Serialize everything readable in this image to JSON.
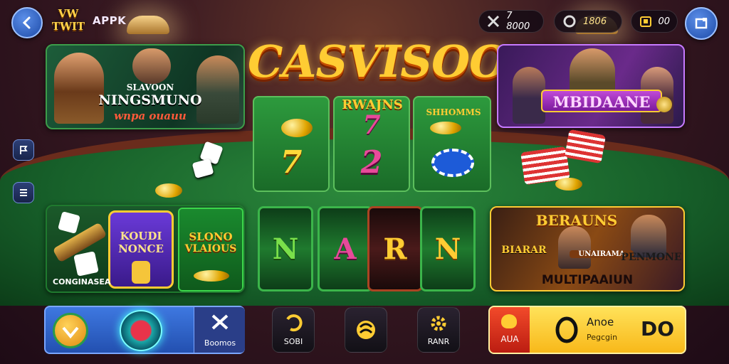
{
  "header": {
    "logo_text": "VW TWIT",
    "app_name": "APPK",
    "currency_1": "7 8000",
    "currency_2": "1806",
    "currency_3": "00"
  },
  "main_logo": "CASVISOO",
  "promo_left": {
    "line1": "SLAVOON",
    "line2": "NINGSMUNO",
    "line3": "wnpa ouauu"
  },
  "promo_right": {
    "title": "MBIDAANE"
  },
  "center_banner": {
    "title": "RWAJNS"
  },
  "small_banner": {
    "title": "SHHOMMS"
  },
  "reels_top": [
    "7",
    "7",
    "2"
  ],
  "reels_bottom": [
    "N",
    "A",
    "R",
    "N"
  ],
  "card_left": {
    "game1_line1": "KOUDI",
    "game1_line2": "NONCE",
    "game2_line1": "SLONO",
    "game2_line2": "VLAIOUS",
    "caption": "CONGINASEA"
  },
  "card_right": {
    "title": "BERAUNS",
    "sub_left": "BIARAR",
    "sub_mid": "UNAIRAMA",
    "sub_right": "PENMONE",
    "caption": "MULTIPAAIUN"
  },
  "bottom_bar": {
    "left_panel_label": "Boomos",
    "btn1_label": "SOBI",
    "btn3_label": "RANR",
    "cta_left_label": "AUA",
    "cta_title": "Anoe",
    "cta_sub": "Pegcgin",
    "cta_value": "DO"
  },
  "colors": {
    "felt": "#1f7a2e",
    "gold": "#ffcc33",
    "accent_blue": "#2d5fc4",
    "cta_yellow": "#ffd23a",
    "cta_red": "#e53a1f"
  },
  "icons": [
    "back-arrow-icon",
    "cross-swords-icon",
    "gem-icon",
    "wallet-icon",
    "window-icon",
    "flag-icon",
    "menu-icon",
    "chip-icon",
    "swirl-icon",
    "gear-icon",
    "ring-icon"
  ]
}
